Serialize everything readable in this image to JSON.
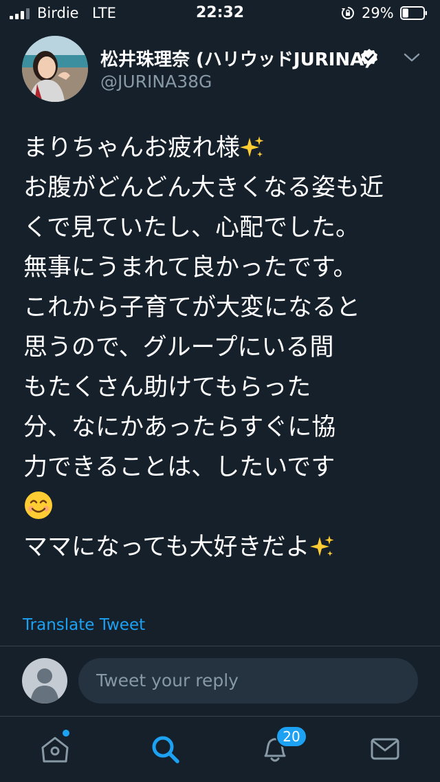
{
  "status_bar": {
    "carrier": "Birdie",
    "network": "LTE",
    "time": "22:32",
    "battery": "29%",
    "battery_level": 0.29
  },
  "tweet": {
    "author_name": "松井珠理奈 (ハリウッドJURINA)",
    "handle": "@JURINA38G",
    "verified": true,
    "lines": [
      "まりちゃんお疲れ様",
      "お腹がどんどん大きくなる姿も近",
      "くで見ていたし、心配でした。",
      "無事にうまれて良かったです。",
      "これから子育てが大変になると",
      "思うので、グループにいる間",
      "もたくさん助けてもらった",
      "分、なにかあったらすぐに協",
      "力できることは、したいです",
      "",
      "ママになっても大好きだよ"
    ],
    "emoji": [
      "sparkles-emoji",
      "smiling-face-emoji",
      "sparkles-emoji"
    ],
    "translate_label": "Translate Tweet"
  },
  "reply": {
    "placeholder": "Tweet your reply"
  },
  "tab_bar": {
    "items": [
      "home-icon",
      "search-icon",
      "notifications-icon",
      "messages-icon"
    ],
    "notifications_badge": "20",
    "active": "search"
  },
  "colors": {
    "background": "#15202b",
    "accent": "#1da1f2",
    "secondary_text": "#8899a6"
  }
}
